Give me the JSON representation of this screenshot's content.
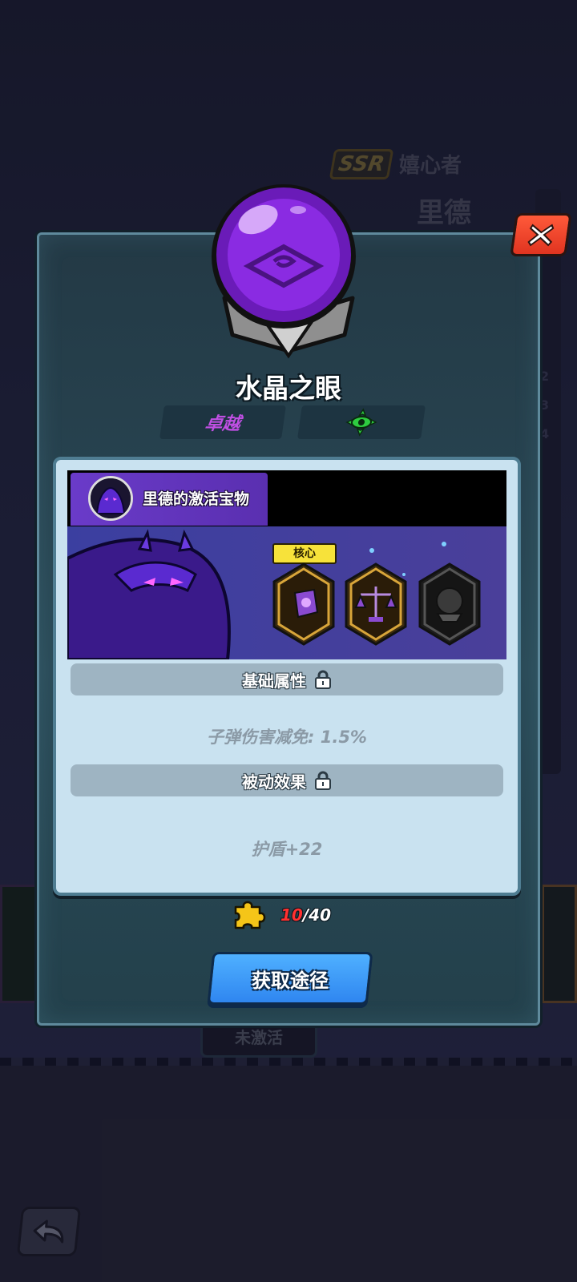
{
  "background": {
    "rarity": "SSR",
    "hero_class": "嬉心者",
    "hero_name": "里德",
    "side_numbers": [
      "2",
      "3",
      "4"
    ],
    "inactive_label": "未激活"
  },
  "modal": {
    "item_name": "水晶之眼",
    "rarity_label": "卓越",
    "element_icon": "green-eye-crest-icon",
    "owner_label": "里德的激活宝物",
    "core_badge": "核心",
    "base_attr_title": "基础属性",
    "base_attr_value": "子弹伤害减免: 1.5%",
    "passive_title": "被动效果",
    "passive_value": "护盾+22",
    "fragments_have": "10",
    "fragments_total": "/40",
    "obtain_button": "获取途径"
  },
  "colors": {
    "rarity_purple": "#c04fe3",
    "accent_blue": "#2f86f0",
    "close_red": "#e03420",
    "fragment_gold": "#f5c518"
  }
}
